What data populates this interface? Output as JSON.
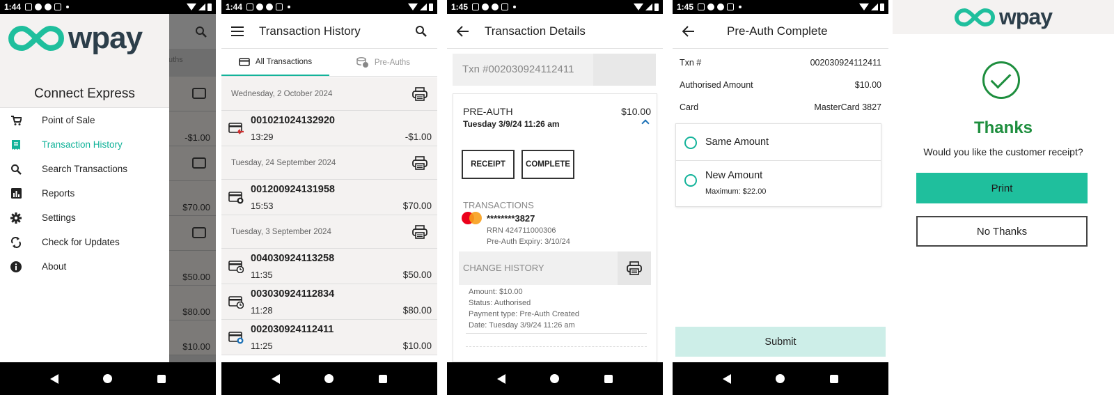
{
  "brand": {
    "name": "wpay",
    "accent": "#13b39a",
    "dark": "#2c3e4a",
    "success": "#1e8e3e"
  },
  "screens": {
    "s1": {
      "status_time": "1:44",
      "app_title": "Connect Express",
      "menu": [
        {
          "label": "Point of Sale",
          "icon": "cart-icon"
        },
        {
          "label": "Transaction History",
          "icon": "receipt-icon"
        },
        {
          "label": "Search Transactions",
          "icon": "search-icon"
        },
        {
          "label": "Reports",
          "icon": "chart-icon"
        },
        {
          "label": "Settings",
          "icon": "gear-icon"
        },
        {
          "label": "Check for Updates",
          "icon": "sync-icon"
        },
        {
          "label": "About",
          "icon": "info-icon"
        }
      ],
      "underlay": {
        "tab": "uths",
        "amounts": [
          "-$1.00",
          "$70.00",
          "$50.00",
          "$80.00",
          "$10.00"
        ]
      }
    },
    "s2": {
      "status_time": "1:44",
      "title": "Transaction History",
      "tabs": [
        "All Transactions",
        "Pre-Auths"
      ],
      "groups": [
        {
          "date": "Wednesday, 2 October 2024",
          "rows": [
            {
              "id": "001021024132920",
              "time": "13:29",
              "amount": "-$1.00",
              "icon": "refund-card-icon"
            }
          ]
        },
        {
          "date": "Tuesday, 24 September 2024",
          "rows": [
            {
              "id": "001200924131958",
              "time": "15:53",
              "amount": "$70.00",
              "icon": "card-coins-icon"
            }
          ]
        },
        {
          "date": "Tuesday, 3 September 2024",
          "rows": [
            {
              "id": "004030924113258",
              "time": "11:35",
              "amount": "$50.00",
              "icon": "card-clock-icon"
            },
            {
              "id": "003030924112834",
              "time": "11:28",
              "amount": "$80.00",
              "icon": "card-clock-icon"
            },
            {
              "id": "002030924112411",
              "time": "11:25",
              "amount": "$10.00",
              "icon": "card-coins-icon"
            }
          ]
        }
      ]
    },
    "s3": {
      "status_time": "1:45",
      "title": "Transaction Details",
      "txn_label": "Txn #002030924112411",
      "type": "PRE-AUTH",
      "amount": "$10.00",
      "date": "Tuesday 3/9/24 11:26 am",
      "receipt_label": "RECEIPT",
      "complete_label": "COMPLETE",
      "transactions_label": "TRANSACTIONS",
      "pan": "********3827",
      "rrn": "RRN  424711000306",
      "expiry": "Pre-Auth Expiry:  3/10/24",
      "change_history_label": "CHANGE HISTORY",
      "history": [
        "Amount:  $10.00",
        "Status:  Authorised",
        "Payment type:  Pre-Auth Created",
        "Date:  Tuesday 3/9/24 11:26 am"
      ]
    },
    "s4": {
      "status_time": "1:45",
      "title": "Pre-Auth Complete",
      "fields": [
        {
          "label": "Txn #",
          "value": "002030924112411"
        },
        {
          "label": "Authorised Amount",
          "value": "$10.00"
        },
        {
          "label": "Card",
          "value": "MasterCard 3827"
        }
      ],
      "option_same": "Same Amount",
      "option_new": "New Amount",
      "option_new_sub": "Maximum: $22.00",
      "submit_label": "Submit"
    },
    "s5": {
      "heading": "Thanks",
      "question": "Would you like the customer receipt?",
      "print_label": "Print",
      "no_label": "No Thanks"
    }
  }
}
